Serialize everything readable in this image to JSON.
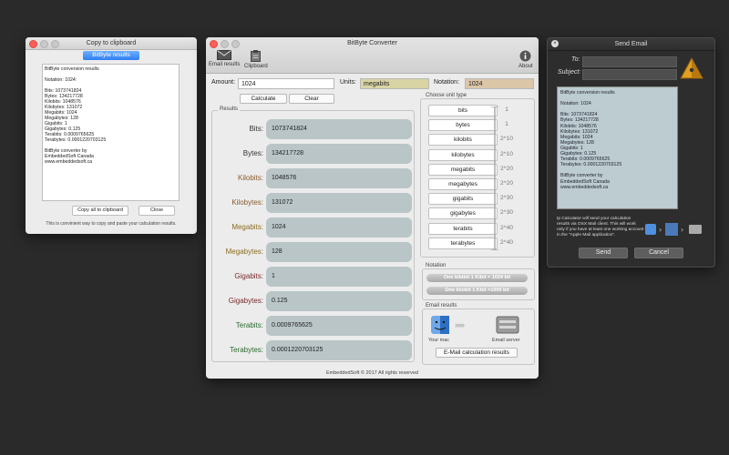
{
  "clipboard": {
    "title": "Copy to clipboard",
    "tab_label": "BitByte results",
    "text": "BitByte conversion results\n\nNotation: 1024:\n\nBits: 1073741824\nBytes: 134217728\nKilobits: 1048576\nKilobytes: 131072\nMegabits: 1024\nMegabytes: 128\nGigabits: 1\nGigabytes: 0.125\nTerabits: 0.0009765625\nTerabytes: 0.0001220703125\n\nBitByte converter by\nEmbeddedSoft Canada\nwww.embeddedsoft.ca",
    "copy_all_label": "Copy all to clipboard",
    "close_label": "Close",
    "note": "This is convinient way to copy and paste your calculation results."
  },
  "main": {
    "title": "BitByte Converter",
    "toolbar": {
      "email_results": "Email results",
      "clipboard": "Clipboard",
      "about": "About"
    },
    "amount_label": "Amount:",
    "amount_value": "1024",
    "units_label": "Units:",
    "units_value": "megabits",
    "notation_label": "Notation:",
    "notation_value": "1024",
    "calculate_label": "Calculate",
    "clear_label": "Clear",
    "results_label": "Results",
    "results": [
      {
        "label": "Bits:",
        "value": "1073741824",
        "color": "#333333"
      },
      {
        "label": "Bytes:",
        "value": "134217728",
        "color": "#333333"
      },
      {
        "label": "Kilobits:",
        "value": "1048576",
        "color": "#8a5a2b"
      },
      {
        "label": "Kilobytes:",
        "value": "131072",
        "color": "#8a5a2b"
      },
      {
        "label": "Megabits:",
        "value": "1024",
        "color": "#8a6d1f"
      },
      {
        "label": "Megabytes:",
        "value": "128",
        "color": "#8a6d1f"
      },
      {
        "label": "Gigabits:",
        "value": "1",
        "color": "#7a2a2a"
      },
      {
        "label": "Gigabytes:",
        "value": "0.125",
        "color": "#7a2a2a"
      },
      {
        "label": "Terabits:",
        "value": "0.0009765625",
        "color": "#2d6a2d"
      },
      {
        "label": "Terabytes:",
        "value": "0.0001220703125",
        "color": "#2d6a2d"
      }
    ],
    "unit_type_label": "Choose unit type",
    "units": [
      "bits",
      "bytes",
      "kilobits",
      "kilobytes",
      "megabits",
      "megabytes",
      "gigabits",
      "gigabytes",
      "terabits",
      "terabytes"
    ],
    "powers": [
      "1",
      "1",
      "2^10",
      "2^10",
      "2^20",
      "2^20",
      "2^30",
      "2^30",
      "2^40",
      "2^40"
    ],
    "notation_group_label": "Notation",
    "notation_1024": "One kibibit 1 Kibit = 1024 bit",
    "notation_1000": "One kilobit 1 Kbit =1000 bit",
    "email_group_label": "Email results",
    "your_mac_label": "Your mac",
    "email_server_label": "Email server",
    "email_button_label": "E-Mail calculation results",
    "footer": "EmbeddedSoft © 2017 All rights reserved"
  },
  "email": {
    "title": "Send Email",
    "to_label": "To:",
    "subject_label": "Subject:",
    "body": "BitByte conversion results\n\nNotation: 1024\n\nBits: 1073741824\nBytes: 134217728\nKilobits: 1048576\nKilobytes: 131072\nMegabits: 1024\nMegabytes: 128\nGigabits: 1\nGigabytes: 0.125\nTerabits: 0.0009765625\nTerabytes: 0.0001220703125\n\nBitByte converter by\nEmbeddedSoft Canada\nwww.embeddedsoft.ca",
    "info": "Ip Calculator will send your calculation results via OSX Mail client. This will work only if you have at least one working account in the \"Apple Mail application\".",
    "send_label": "Send",
    "cancel_label": "Cancel"
  }
}
